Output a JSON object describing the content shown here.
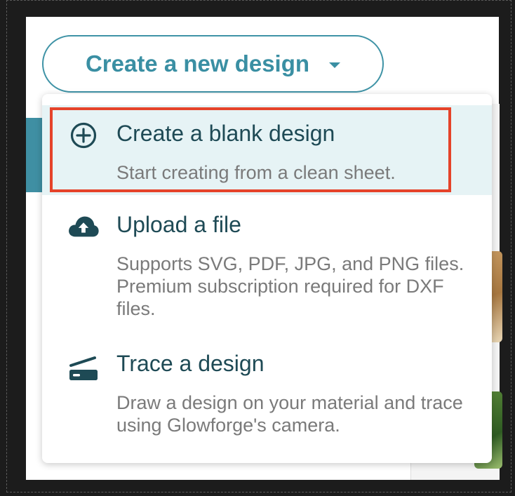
{
  "create_button": {
    "label": "Create a new design"
  },
  "menu": {
    "items": [
      {
        "id": "blank",
        "icon": "plus-circle-icon",
        "title": "Create a blank design",
        "description": "Start creating from a clean sheet."
      },
      {
        "id": "upload",
        "icon": "cloud-upload-icon",
        "title": "Upload a file",
        "description": "Supports SVG, PDF, JPG, and PNG files. Premium subscription required for DXF files."
      },
      {
        "id": "trace",
        "icon": "scanner-icon",
        "title": "Trace a design",
        "description": "Draw a design on your material and trace using Glowforge's camera."
      }
    ]
  },
  "colors": {
    "accent": "#3a8fa3",
    "title_text": "#1e4a55",
    "description_text": "#7a7a7a",
    "highlight_bg": "#e6f3f5",
    "annotation_border": "#e5432a"
  }
}
